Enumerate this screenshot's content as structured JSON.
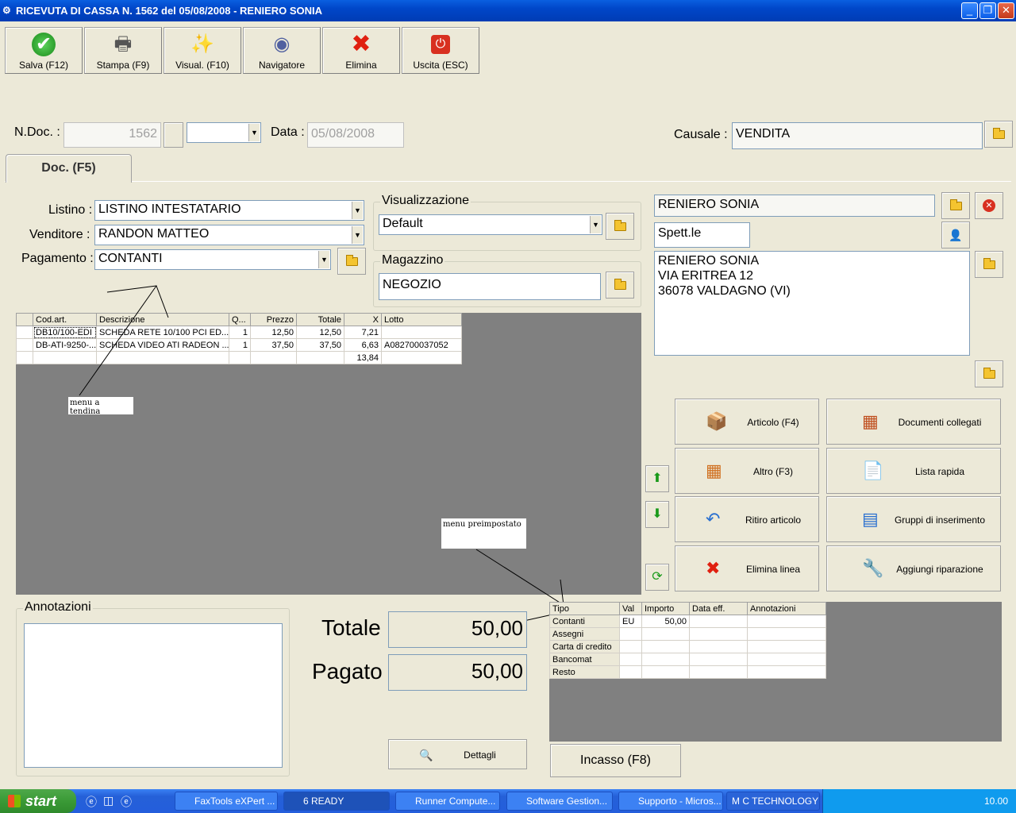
{
  "window": {
    "title": "RICEVUTA DI CASSA N. 1562  del 05/08/2008 - RENIERO SONIA",
    "min": "_",
    "max": "❐",
    "close": "✕"
  },
  "toolbar": [
    {
      "label": "Salva (F12)",
      "icon": "save-check-icon",
      "glyph": "✔"
    },
    {
      "label": "Stampa (F9)",
      "icon": "printer-icon",
      "glyph": "🖶"
    },
    {
      "label": "Visual. (F10)",
      "icon": "magic-wand-icon",
      "glyph": "✨"
    },
    {
      "label": "Navigatore",
      "icon": "compass-icon",
      "glyph": "◉"
    },
    {
      "label": "Elimina",
      "icon": "delete-x-icon",
      "glyph": "✖"
    },
    {
      "label": "Uscita (ESC)",
      "icon": "power-icon",
      "glyph": "⏻"
    }
  ],
  "header": {
    "ndoc_label": "N.Doc. :",
    "ndoc_value": "1562",
    "data_label": "Data :",
    "data_value": "05/08/2008",
    "causale_label": "Causale :",
    "causale_value": "VENDITA"
  },
  "tab": {
    "label": "Doc. (F5)"
  },
  "form": {
    "listino_label": "Listino :",
    "listino_value": "LISTINO INTESTATARIO",
    "venditore_label": "Venditore :",
    "venditore_value": "RANDON MATTEO",
    "pagamento_label": "Pagamento :",
    "pagamento_value": "CONTANTI",
    "visualizzazione_label": "Visualizzazione",
    "visualizzazione_value": "Default",
    "magazzino_label": "Magazzino",
    "magazzino_value": "NEGOZIO"
  },
  "customer": {
    "name": "RENIERO SONIA",
    "salutation": "Spett.le",
    "address_line1": "RENIERO SONIA",
    "address_line2": "VIA ERITREA 12",
    "address_line3": "36078 VALDAGNO (VI)"
  },
  "items": {
    "columns": [
      "",
      "Cod.art.",
      "Descrizione",
      "Q...",
      "Prezzo",
      "Totale",
      "X",
      "Lotto"
    ],
    "rows": [
      [
        "",
        "DB10/100-EDI",
        "SCHEDA RETE 10/100 PCI ED...",
        "1",
        "12,50",
        "12,50",
        "7,21",
        ""
      ],
      [
        "",
        "DB-ATI-9250-...",
        "SCHEDA VIDEO ATI RADEON ...",
        "1",
        "37,50",
        "37,50",
        "6,63",
        "A082700037052"
      ],
      [
        "",
        "",
        "",
        "",
        "",
        "",
        "13,84",
        ""
      ]
    ]
  },
  "notes": {
    "menu_tendina": "menu a tendina",
    "menu_preimpostato": "menu preimpostato"
  },
  "actions": [
    {
      "label": "Articolo (F4)",
      "icon": "article-box-icon",
      "glyph": "📦"
    },
    {
      "label": "Documenti collegati",
      "icon": "linked-docs-icon",
      "glyph": "▦"
    },
    {
      "label": "Altro (F3)",
      "icon": "grid-add-icon",
      "glyph": "▦"
    },
    {
      "label": "Lista rapida",
      "icon": "quick-list-icon",
      "glyph": "📄"
    },
    {
      "label": "Ritiro articolo",
      "icon": "undo-arrow-icon",
      "glyph": "↶"
    },
    {
      "label": "Gruppi di inserimento",
      "icon": "group-insert-icon",
      "glyph": "▤"
    },
    {
      "label": "Elimina linea",
      "icon": "delete-line-icon",
      "glyph": "✖"
    },
    {
      "label": "Aggiungi riparazione",
      "icon": "wrench-icon",
      "glyph": "🔧"
    }
  ],
  "annotazioni_label": "Annotazioni",
  "totals": {
    "totale_label": "Totale",
    "totale_value": "50,00",
    "pagato_label": "Pagato",
    "pagato_value": "50,00"
  },
  "payments": {
    "columns": [
      "Tipo",
      "Val",
      "Importo",
      "Data eff.",
      "Annotazioni"
    ],
    "rows": [
      [
        "Contanti",
        "EU",
        "50,00",
        "",
        ""
      ],
      [
        "Assegni",
        "",
        "",
        "",
        ""
      ],
      [
        "Carta di credito",
        "",
        "",
        "",
        ""
      ],
      [
        "Bancomat",
        "",
        "",
        "",
        ""
      ],
      [
        "Resto",
        "",
        "",
        "",
        ""
      ]
    ]
  },
  "buttons": {
    "dettagli": "Dettagli",
    "incasso": "Incasso (F8)"
  },
  "taskbar": {
    "start": "start",
    "tasks": [
      "FaxTools eXPert ...",
      "6 READY",
      "Runner Compute...",
      "Software Gestion...",
      "Supporto - Micros...",
      "M C TECHNOLOGY"
    ],
    "clock": "10.00"
  }
}
